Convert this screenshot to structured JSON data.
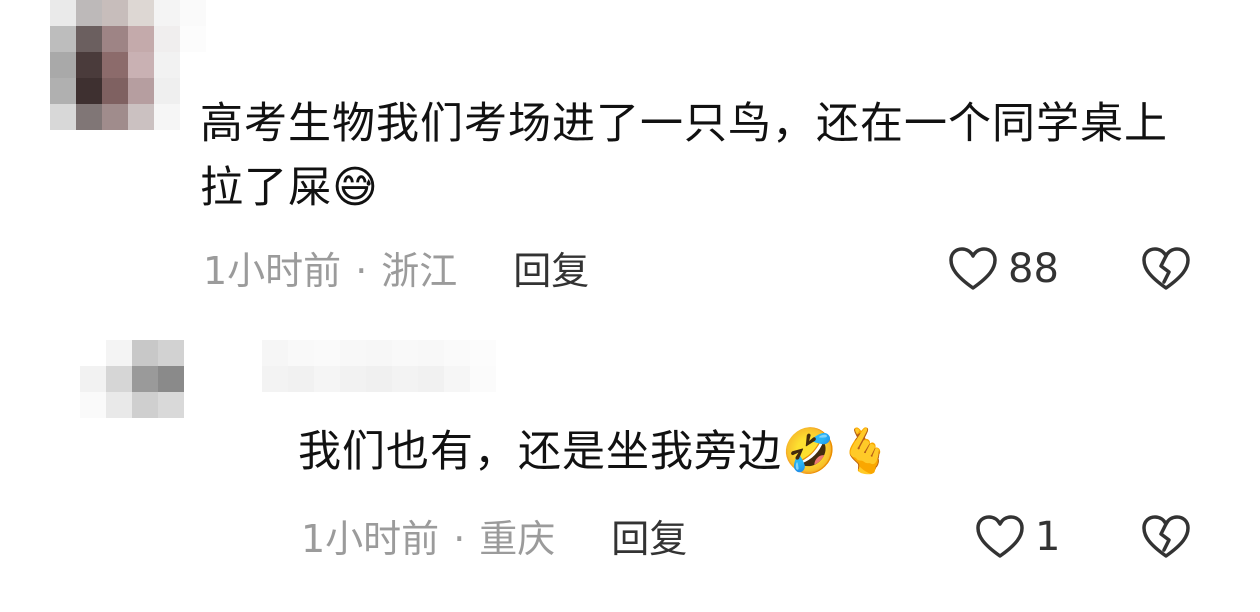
{
  "comments": [
    {
      "text": "高考生物我们考场进了一只鸟，还在一个同学桌上拉了屎",
      "emojis": [
        "😅"
      ],
      "time": "1小时前",
      "location": "浙江",
      "reply_label": "回复",
      "likes": "88"
    },
    {
      "text": "我们也有，还是坐我旁边",
      "emojis": [
        "🤣",
        "🫰"
      ],
      "time": "1小时前",
      "location": "重庆",
      "reply_label": "回复",
      "likes": "1"
    }
  ],
  "separator": "·",
  "icons": {
    "like": "heart-outline-icon",
    "dislike": "broken-heart-icon"
  },
  "colors": {
    "text": "#111111",
    "meta": "#9b9b9b",
    "reply": "#333333"
  }
}
